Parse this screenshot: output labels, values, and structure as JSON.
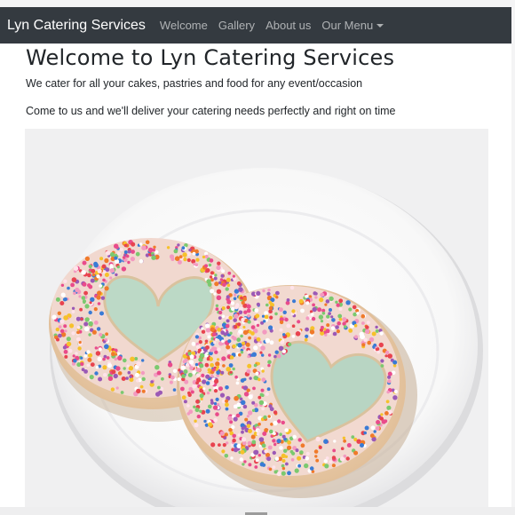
{
  "navbar": {
    "brand": "Lyn Catering Services",
    "links": [
      {
        "label": "Welcome"
      },
      {
        "label": "Gallery"
      },
      {
        "label": "About us"
      },
      {
        "label": "Our Menu",
        "has_dropdown": true
      }
    ]
  },
  "main": {
    "title": "Welcome to Lyn Catering Services",
    "paragraphs": [
      "We cater for all your cakes, pastries and food for any event/occasion",
      "Come to us and we'll deliver your catering needs perfectly and right on time"
    ],
    "hero_image": "sprinkle-heart-cookies-on-plate"
  },
  "colors": {
    "navbar_bg": "#343a40",
    "brand": "#ffffff",
    "nav_link": "rgba(255,255,255,0.6)",
    "page_bg": "#ffffff",
    "text": "#212529",
    "image_bg": "#f0f0f1"
  }
}
